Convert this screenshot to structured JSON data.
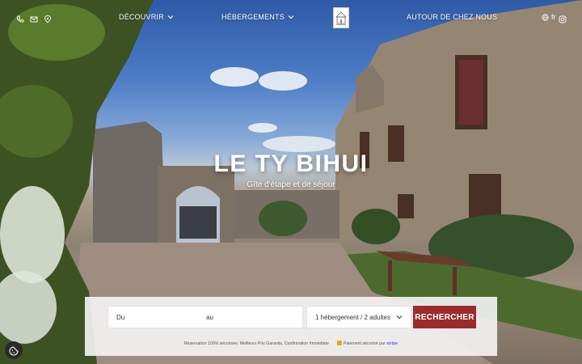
{
  "nav": {
    "items": [
      {
        "label": "DÉCOUVRIR",
        "has_dropdown": true
      },
      {
        "label": "HÉBERGEMENTS",
        "has_dropdown": true
      },
      {
        "label": "AUTOUR DE CHEZ NOUS",
        "has_dropdown": false
      }
    ],
    "contact_icons": [
      "phone-icon",
      "mail-icon",
      "map-pin-icon"
    ],
    "language": "fr",
    "social_icon": "instagram-icon"
  },
  "hero": {
    "title": "LE TY BIHUI",
    "subtitle": "Gîte d'étape et de séjour"
  },
  "search": {
    "from_placeholder": "Du",
    "to_placeholder": "au",
    "guests_value": "1 hébergement / 2 adultes",
    "button_label": "RECHERCHER",
    "assurance_text": "Réservation 100% sécurisée, Meilleurs Prix Garantis, Confirmation Immédiate",
    "payment_text": "Paiement sécurisé par",
    "payment_provider": "stripe"
  },
  "colors": {
    "accent": "#9b2b2c",
    "stripe": "#635bff"
  }
}
